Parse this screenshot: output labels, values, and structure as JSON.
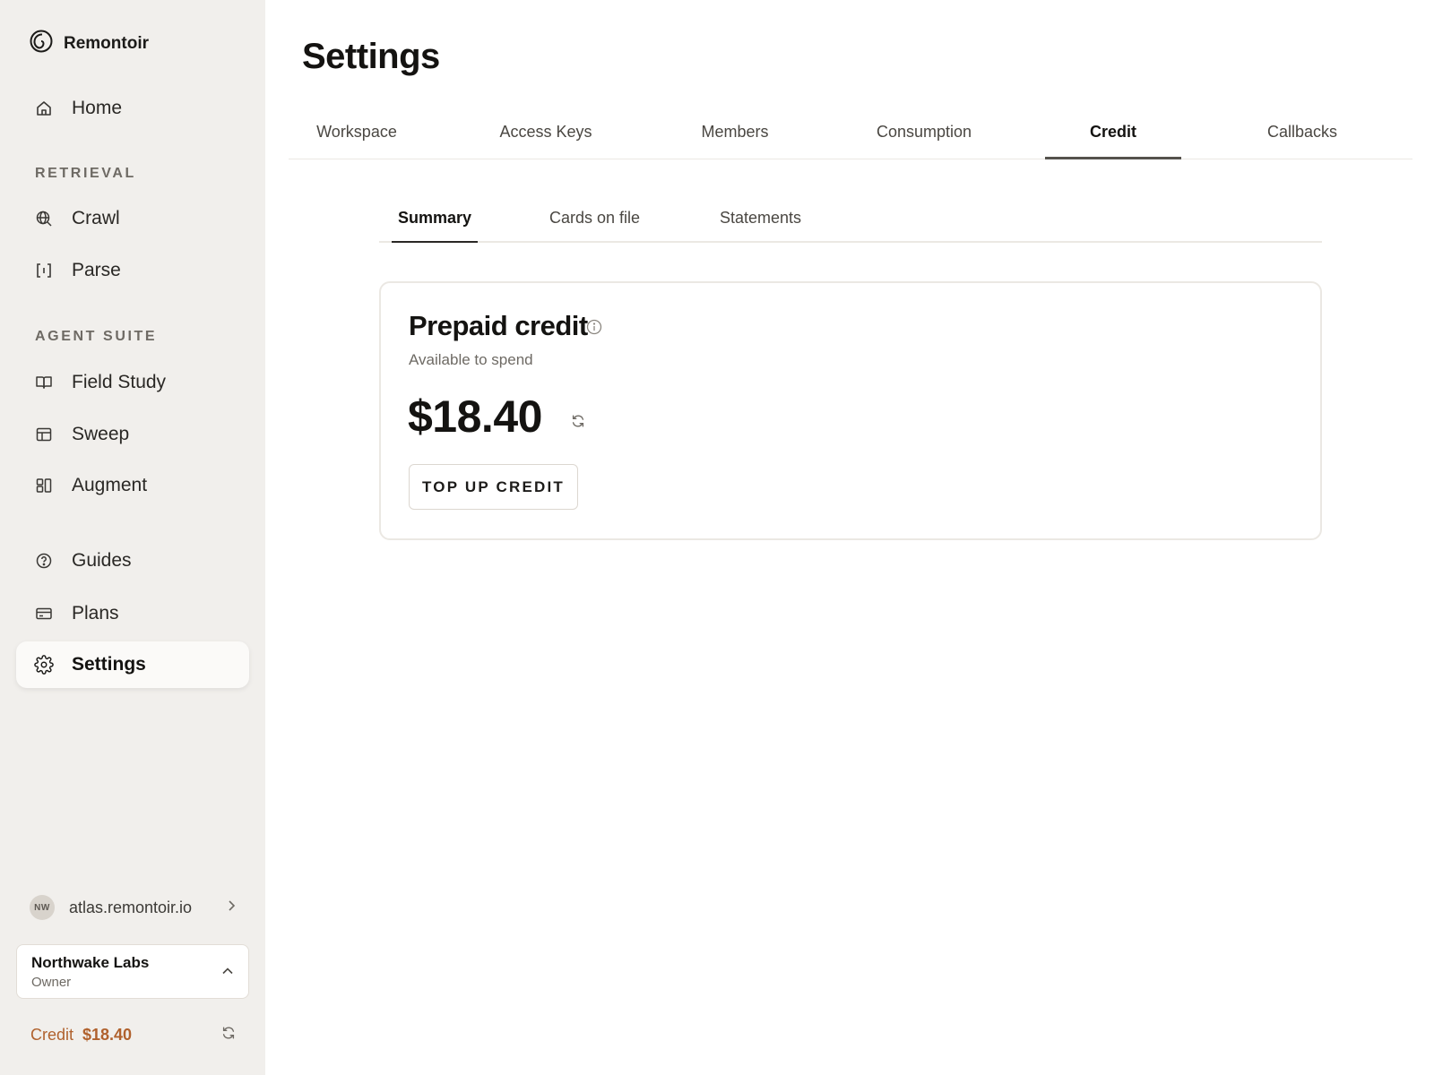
{
  "brand": {
    "name": "Remontoir",
    "icon": "spiral-logo-icon"
  },
  "sidebar": {
    "home": {
      "label": "Home",
      "icon": "home-icon"
    },
    "sections": [
      {
        "title": "RETRIEVAL",
        "items": [
          {
            "label": "Crawl",
            "icon": "globe-search-icon"
          },
          {
            "label": "Parse",
            "icon": "bracket-parse-icon"
          }
        ]
      },
      {
        "title": "AGENT SUITE",
        "items": [
          {
            "label": "Field Study",
            "icon": "open-book-icon"
          },
          {
            "label": "Sweep",
            "icon": "table-layout-icon"
          },
          {
            "label": "Augment",
            "icon": "blocks-icon"
          }
        ]
      }
    ],
    "bottom_items": [
      {
        "label": "Guides",
        "icon": "question-circle-icon"
      },
      {
        "label": "Plans",
        "icon": "credit-card-icon"
      },
      {
        "label": "Settings",
        "icon": "gear-icon",
        "active": true
      }
    ],
    "workspace": {
      "avatar_initials": "NW",
      "host": "atlas.remontoir.io"
    },
    "org": {
      "name": "Northwake Labs",
      "role": "Owner"
    },
    "credit": {
      "label": "Credit",
      "value": "$18.40",
      "color": "#b0612d"
    }
  },
  "main": {
    "title": "Settings",
    "tabs": [
      {
        "label": "Workspace"
      },
      {
        "label": "Access Keys"
      },
      {
        "label": "Members"
      },
      {
        "label": "Consumption"
      },
      {
        "label": "Credit",
        "active": true
      },
      {
        "label": "Callbacks"
      }
    ],
    "subtabs": [
      {
        "label": "Summary",
        "active": true
      },
      {
        "label": "Cards on file"
      },
      {
        "label": "Statements"
      }
    ],
    "card": {
      "title": "Prepaid credit",
      "subtitle": "Available to spend",
      "amount": "$18.40",
      "button_label": "TOP UP CREDIT"
    }
  }
}
